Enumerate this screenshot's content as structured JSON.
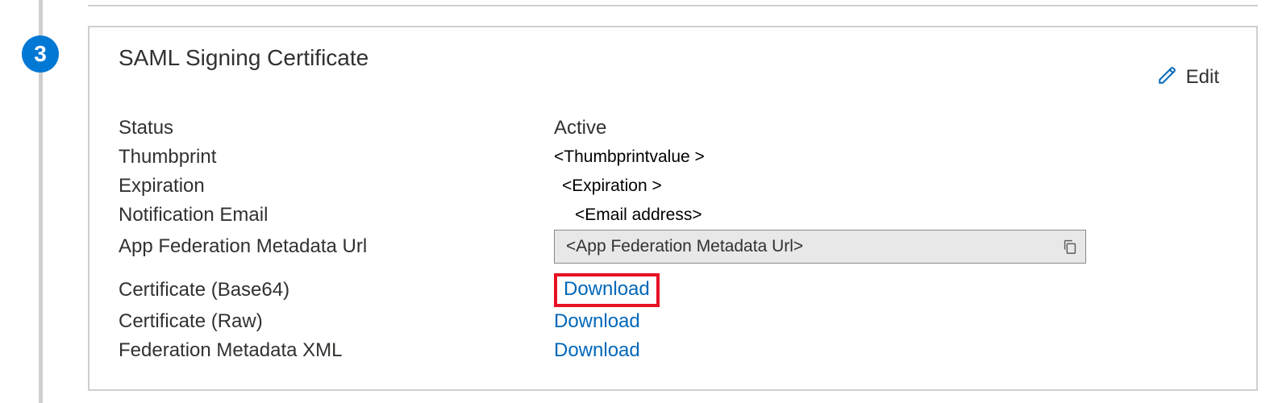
{
  "step": {
    "number": "3"
  },
  "card": {
    "title": "SAML Signing Certificate",
    "edit_label": "Edit",
    "fields": {
      "status_label": "Status",
      "status_value": "Active",
      "thumbprint_label": "Thumbprint",
      "thumbprint_value": "<Thumbprintvalue >",
      "expiration_label": "Expiration",
      "expiration_value": "<Expiration >",
      "notification_email_label": "Notification Email",
      "notification_email_value": "<Email address>",
      "app_fed_url_label": "App Federation Metadata Url",
      "app_fed_url_value": "<App Federation Metadata Url>",
      "cert_base64_label": "Certificate (Base64)",
      "cert_base64_link": "Download",
      "cert_raw_label": "Certificate (Raw)",
      "cert_raw_link": "Download",
      "fed_xml_label": "Federation Metadata XML",
      "fed_xml_link": "Download"
    }
  }
}
